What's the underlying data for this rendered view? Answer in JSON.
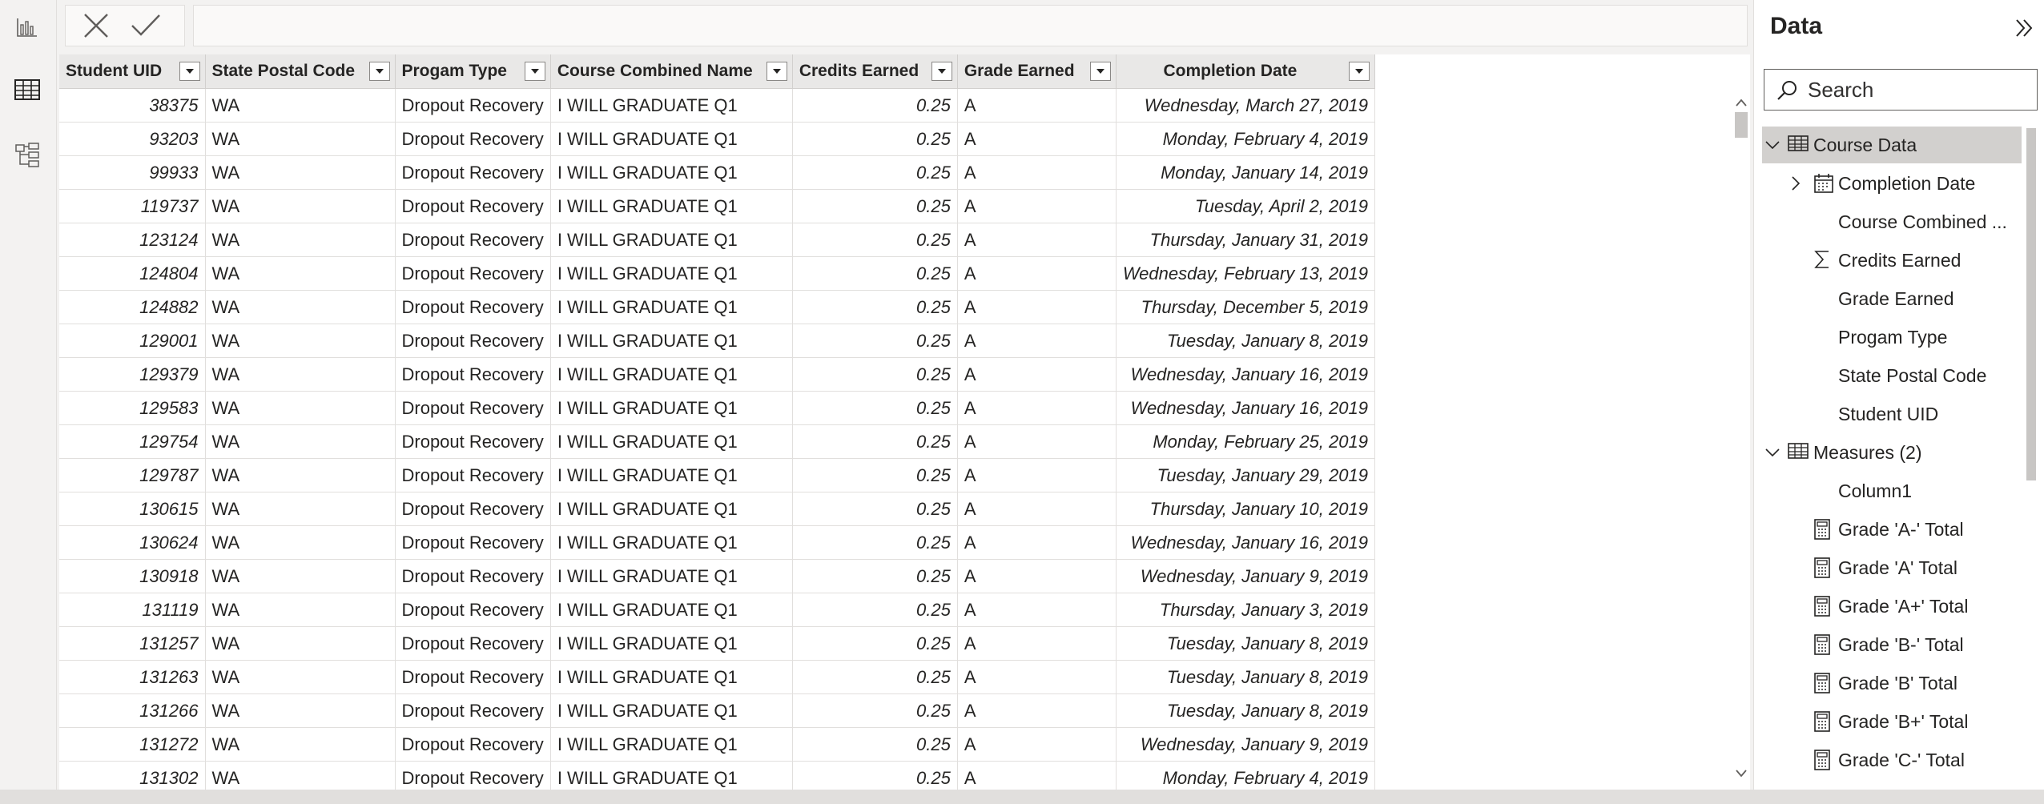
{
  "left_rail": {
    "items": [
      {
        "name": "report-view-icon"
      },
      {
        "name": "table-view-icon"
      },
      {
        "name": "model-view-icon"
      }
    ]
  },
  "formula_bar": {
    "cancel_icon": "close-icon",
    "commit_icon": "check-icon",
    "value": ""
  },
  "table": {
    "columns": [
      "Student UID",
      "State Postal Code",
      "Progam Type",
      "Course Combined Name",
      "Credits Earned",
      "Grade Earned",
      "Completion Date"
    ],
    "rows": [
      [
        "38375",
        "WA",
        "Dropout Recovery",
        "I WILL GRADUATE Q1",
        "0.25",
        "A",
        "Wednesday, March 27, 2019"
      ],
      [
        "93203",
        "WA",
        "Dropout Recovery",
        "I WILL GRADUATE Q1",
        "0.25",
        "A",
        "Monday, February 4, 2019"
      ],
      [
        "99933",
        "WA",
        "Dropout Recovery",
        "I WILL GRADUATE Q1",
        "0.25",
        "A",
        "Monday, January 14, 2019"
      ],
      [
        "119737",
        "WA",
        "Dropout Recovery",
        "I WILL GRADUATE Q1",
        "0.25",
        "A",
        "Tuesday, April 2, 2019"
      ],
      [
        "123124",
        "WA",
        "Dropout Recovery",
        "I WILL GRADUATE Q1",
        "0.25",
        "A",
        "Thursday, January 31, 2019"
      ],
      [
        "124804",
        "WA",
        "Dropout Recovery",
        "I WILL GRADUATE Q1",
        "0.25",
        "A",
        "Wednesday, February 13, 2019"
      ],
      [
        "124882",
        "WA",
        "Dropout Recovery",
        "I WILL GRADUATE Q1",
        "0.25",
        "A",
        "Thursday, December 5, 2019"
      ],
      [
        "129001",
        "WA",
        "Dropout Recovery",
        "I WILL GRADUATE Q1",
        "0.25",
        "A",
        "Tuesday, January 8, 2019"
      ],
      [
        "129379",
        "WA",
        "Dropout Recovery",
        "I WILL GRADUATE Q1",
        "0.25",
        "A",
        "Wednesday, January 16, 2019"
      ],
      [
        "129583",
        "WA",
        "Dropout Recovery",
        "I WILL GRADUATE Q1",
        "0.25",
        "A",
        "Wednesday, January 16, 2019"
      ],
      [
        "129754",
        "WA",
        "Dropout Recovery",
        "I WILL GRADUATE Q1",
        "0.25",
        "A",
        "Monday, February 25, 2019"
      ],
      [
        "129787",
        "WA",
        "Dropout Recovery",
        "I WILL GRADUATE Q1",
        "0.25",
        "A",
        "Tuesday, January 29, 2019"
      ],
      [
        "130615",
        "WA",
        "Dropout Recovery",
        "I WILL GRADUATE Q1",
        "0.25",
        "A",
        "Thursday, January 10, 2019"
      ],
      [
        "130624",
        "WA",
        "Dropout Recovery",
        "I WILL GRADUATE Q1",
        "0.25",
        "A",
        "Wednesday, January 16, 2019"
      ],
      [
        "130918",
        "WA",
        "Dropout Recovery",
        "I WILL GRADUATE Q1",
        "0.25",
        "A",
        "Wednesday, January 9, 2019"
      ],
      [
        "131119",
        "WA",
        "Dropout Recovery",
        "I WILL GRADUATE Q1",
        "0.25",
        "A",
        "Thursday, January 3, 2019"
      ],
      [
        "131257",
        "WA",
        "Dropout Recovery",
        "I WILL GRADUATE Q1",
        "0.25",
        "A",
        "Tuesday, January 8, 2019"
      ],
      [
        "131263",
        "WA",
        "Dropout Recovery",
        "I WILL GRADUATE Q1",
        "0.25",
        "A",
        "Tuesday, January 8, 2019"
      ],
      [
        "131266",
        "WA",
        "Dropout Recovery",
        "I WILL GRADUATE Q1",
        "0.25",
        "A",
        "Tuesday, January 8, 2019"
      ],
      [
        "131272",
        "WA",
        "Dropout Recovery",
        "I WILL GRADUATE Q1",
        "0.25",
        "A",
        "Wednesday, January 9, 2019"
      ],
      [
        "131302",
        "WA",
        "Dropout Recovery",
        "I WILL GRADUATE Q1",
        "0.25",
        "A",
        "Monday, February 4, 2019"
      ]
    ]
  },
  "data_pane": {
    "title": "Data",
    "search_placeholder": "Search",
    "items": [
      {
        "label": "Course Data",
        "icon": "table-icon",
        "level": 0,
        "expander": "expanded",
        "selected": true
      },
      {
        "label": "Completion Date",
        "icon": "calendar-icon",
        "level": 1,
        "expander": "collapsed"
      },
      {
        "label": "Course Combined ...",
        "icon": "",
        "level": 1
      },
      {
        "label": "Credits Earned",
        "icon": "sigma-icon",
        "level": 1
      },
      {
        "label": "Grade Earned",
        "icon": "",
        "level": 1
      },
      {
        "label": "Progam Type",
        "icon": "",
        "level": 1
      },
      {
        "label": "State Postal Code",
        "icon": "",
        "level": 1
      },
      {
        "label": "Student UID",
        "icon": "",
        "level": 1
      },
      {
        "label": "Measures (2)",
        "icon": "table-icon",
        "level": 0,
        "expander": "expanded"
      },
      {
        "label": "Column1",
        "icon": "",
        "level": 1
      },
      {
        "label": "Grade 'A-' Total",
        "icon": "calculator-icon",
        "level": 1
      },
      {
        "label": "Grade 'A' Total",
        "icon": "calculator-icon",
        "level": 1
      },
      {
        "label": "Grade 'A+' Total",
        "icon": "calculator-icon",
        "level": 1
      },
      {
        "label": "Grade 'B-' Total",
        "icon": "calculator-icon",
        "level": 1
      },
      {
        "label": "Grade 'B' Total",
        "icon": "calculator-icon",
        "level": 1
      },
      {
        "label": "Grade 'B+' Total",
        "icon": "calculator-icon",
        "level": 1
      },
      {
        "label": "Grade 'C-' Total",
        "icon": "calculator-icon",
        "level": 1
      }
    ]
  }
}
